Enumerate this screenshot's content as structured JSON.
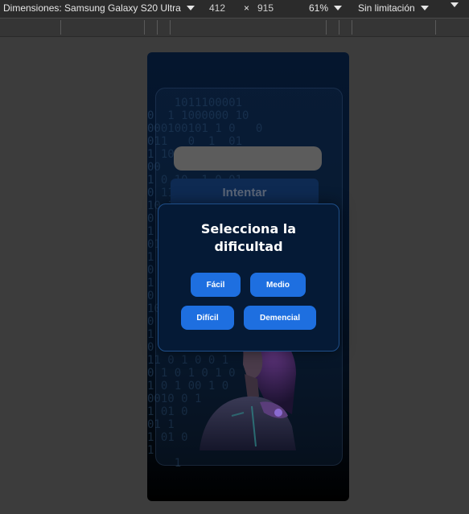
{
  "toolbar": {
    "device_label": "Dimensiones: Samsung Galaxy S20 Ultra",
    "width": "412",
    "times": "×",
    "height": "915",
    "zoom": "61%",
    "throttle": "Sin limitación"
  },
  "app": {
    "input_placeholder": "",
    "try_button": "Intentar",
    "code_lines": [
      "    1011100001",
      "0  1 1000000 10",
      "000100101 1 0   0",
      "011   0  1  01",
      "1 10 0 1 0  1 1",
      "00   1 11 0 10",
      "1 0 10  1 0 01",
      "0 11 0 0 1 0",
      "10 1 1 00  1 10",
      "0 01 1 0 11 0",
      "1 0 0 1 0 1",
      "01 1 0 1 0 0 1",
      "1 0 11 0 1 00",
      "0 1 0 0 10 1 0",
      "1 0 001 0 1",
      "0  1 0 1 0 01",
      "10 0 1 0 1 0",
      "0  1  11 0 1",
      "1 0 0 1 0 1",
      "0   1 0  1 0",
      "11 0 1 0 0 1",
      "0 1 0 1 0 1 0",
      "1 0 1 00 1 0",
      "0010 0 1",
      "1 01 0",
      "01 1",
      "1 01 0",
      "1",
      "    1"
    ]
  },
  "modal": {
    "title_line1": "Selecciona la",
    "title_line2": "dificultad",
    "buttons": {
      "easy": "Fácil",
      "medium": "Medio",
      "hard": "Difícil",
      "insane": "Demencial"
    }
  },
  "colors": {
    "accent": "#1e6fe0",
    "modal_bg": "#051a36",
    "page_bg": "#3c3c3c"
  }
}
